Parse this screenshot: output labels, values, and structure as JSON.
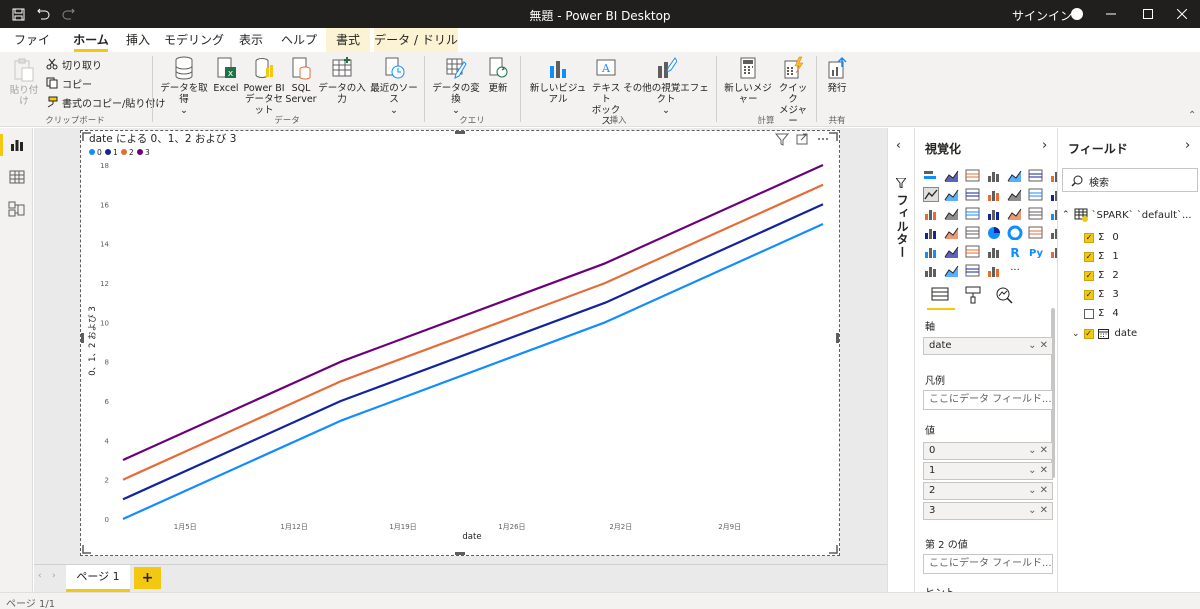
{
  "window": {
    "title": "無題 - Power BI Desktop",
    "signin": "サインイン"
  },
  "tabs": [
    {
      "label": "ファイル",
      "active": false
    },
    {
      "label": "ホーム",
      "active": true
    },
    {
      "label": "挿入",
      "active": false
    },
    {
      "label": "モデリング",
      "active": false
    },
    {
      "label": "表示",
      "active": false
    },
    {
      "label": "ヘルプ",
      "active": false
    },
    {
      "label": "書式",
      "active": false
    },
    {
      "label": "データ / ドリル",
      "active": false
    }
  ],
  "ribbon": {
    "paste": "貼り付け",
    "cut": "切り取り",
    "copy": "コピー",
    "format_painter": "書式のコピー/貼り付け",
    "clipboard_group": "クリップボード",
    "get_data": "データを取得",
    "excel": "Excel",
    "pbi_dataset_1": "Power BI",
    "pbi_dataset_2": "データセット",
    "sql_1": "SQL",
    "sql_2": "Server",
    "enter_data": "データの入力",
    "recent_sources": "最近のソース",
    "data_group": "データ",
    "transform": "データの変換",
    "refresh": "更新",
    "query_group": "クエリ",
    "new_visual": "新しいビジュアル",
    "textbox_1": "テキスト",
    "textbox_2": "ボックス",
    "more_visuals": "その他の視覚エフェクト",
    "insert_group": "挿入",
    "new_measure": "新しいメジャー",
    "quick_measure_1": "クイック",
    "quick_measure_2": "メジャー",
    "calc_group": "計算",
    "publish": "発行",
    "share_group": "共有"
  },
  "chart_data": {
    "type": "line",
    "title": "date による 0、1、2 および 3",
    "xlabel": "date",
    "ylabel": "0、1、2 および 3",
    "x": [
      "2020-01-01",
      "2020-01-15",
      "2020-02-01",
      "2020-02-15"
    ],
    "x_ticks": [
      "1月5日",
      "1月12日",
      "1月19日",
      "1月26日",
      "2月2日",
      "2月9日"
    ],
    "y_ticks": [
      0,
      2,
      4,
      6,
      8,
      10,
      12,
      14,
      16,
      18
    ],
    "ylim": [
      0,
      18
    ],
    "legend_position": "top-left",
    "series": [
      {
        "name": "0",
        "color": "#118dff",
        "values": [
          0,
          5,
          10,
          15
        ]
      },
      {
        "name": "1",
        "color": "#12239e",
        "values": [
          1,
          6,
          11,
          16
        ]
      },
      {
        "name": "2",
        "color": "#e66c37",
        "values": [
          2,
          7,
          12,
          17
        ]
      },
      {
        "name": "3",
        "color": "#6b007b",
        "values": [
          3,
          8,
          13,
          18
        ]
      }
    ]
  },
  "filters_label": "フィルター",
  "viz_pane": {
    "title": "視覚化",
    "axis_head": "軸",
    "axis_field": "date",
    "legend_head": "凡例",
    "placeholder": "ここにデータ フィールド...",
    "values_head": "値",
    "values": [
      "0",
      "1",
      "2",
      "3"
    ],
    "secondary_head": "第 2 の値",
    "tooltip_head": "ヒント"
  },
  "fields_pane": {
    "title": "フィールド",
    "search_placeholder": "検索",
    "table_name": "`SPARK` `default`...",
    "fields": [
      {
        "label": "0",
        "checked": true
      },
      {
        "label": "1",
        "checked": true
      },
      {
        "label": "2",
        "checked": true
      },
      {
        "label": "3",
        "checked": true
      },
      {
        "label": "4",
        "checked": false
      }
    ],
    "date_field": "date"
  },
  "page_tab": "ページ 1",
  "status": "ページ 1/1"
}
